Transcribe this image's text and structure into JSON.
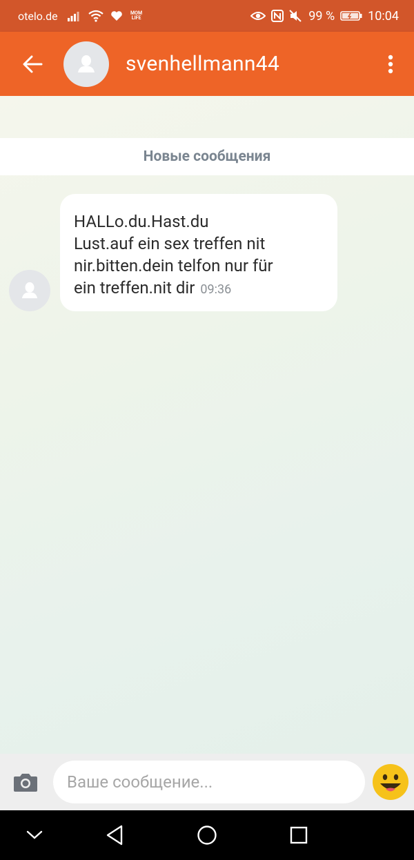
{
  "status_bar": {
    "carrier": "otelo.de",
    "app_badge": "MOM LIFE",
    "battery": "99 %",
    "time": "10:04"
  },
  "header": {
    "title": "svenhellmann44"
  },
  "chat": {
    "divider": "Новые сообщения",
    "message": {
      "text": "HALLo.du.Hast.du\nLust.auf ein sex treffen nit\nnir.bitten.dein telfon nur für\nein treffen.nit dir",
      "time": "09:36"
    }
  },
  "composer": {
    "placeholder": "Ваше сообщение..."
  },
  "colors": {
    "status_bar": "#d2562a",
    "app_bar": "#ee6427",
    "bubble": "#ffffff",
    "input_bar": "#eeeeee"
  }
}
